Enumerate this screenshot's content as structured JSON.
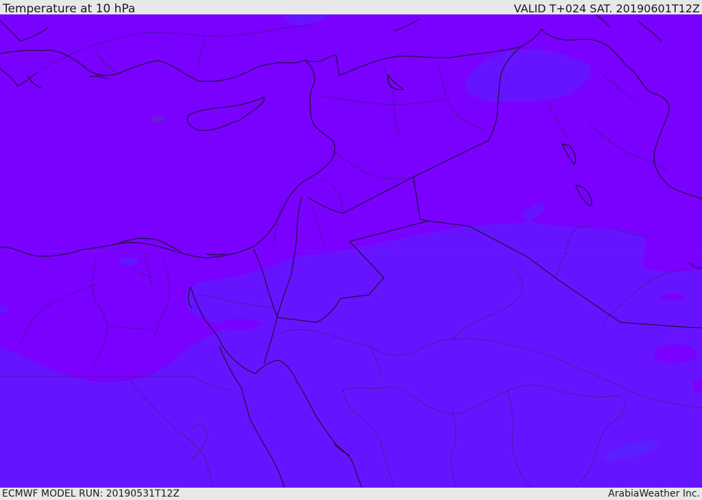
{
  "header": {
    "title": "Temperature at 10 hPa",
    "valid_time": "VALID T+024 SAT. 20190601T12Z"
  },
  "footer": {
    "model_run": "ECMWF MODEL RUN: 20190531T12Z",
    "credit": "ArabiaWeather Inc."
  },
  "map": {
    "colors": {
      "warm_field": "#7a00ff",
      "cool_field": "#6614ff",
      "boundary_line": "#111111"
    }
  }
}
